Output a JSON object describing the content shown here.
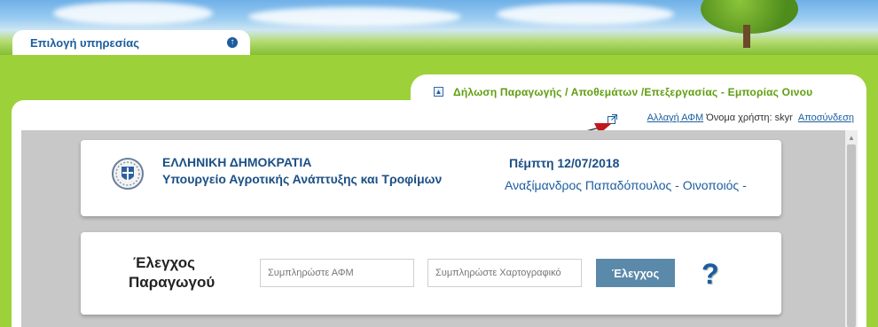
{
  "service_tab": {
    "label": "Επιλογή υπηρεσίας",
    "icon": "collapse-icon"
  },
  "app_title": {
    "label": "Δήλωση Παραγωγής / Αποθεμάτων /Επεξεργασίας - Εμπορίας Οινου",
    "icon": "collapse-small-icon"
  },
  "userbar": {
    "change_afm": "Αλλαγή ΑΦΜ",
    "username_label": "Όνομα χρήστη: skyr",
    "logout": "Αποσύνδεση"
  },
  "header_card": {
    "title1": "ΕΛΛΗΝΙΚΗ ΔΗΜΟΚΡΑΤΙΑ",
    "title2": "Υπουργείο Αγροτικής Ανάπτυξης και Τροφίμων",
    "date": "Πέμπτη 12/07/2018",
    "person": "Αναξίμανδρος Παπαδόπουλος - Οινοποιός -"
  },
  "producer_check": {
    "label_line1": "Έλεγχος",
    "label_line2": "Παραγωγού",
    "afm_placeholder": "Συμπληρώστε ΑΦΜ",
    "map_placeholder": "Συμπληρώστε Χαρτογραφικό",
    "check_button": "Έλεγχος",
    "help_symbol": "?"
  },
  "colors": {
    "page_green": "#9dd13a",
    "title_green": "#5e9e10",
    "brand_blue": "#1b5c9e",
    "button": "#5b89aa"
  }
}
